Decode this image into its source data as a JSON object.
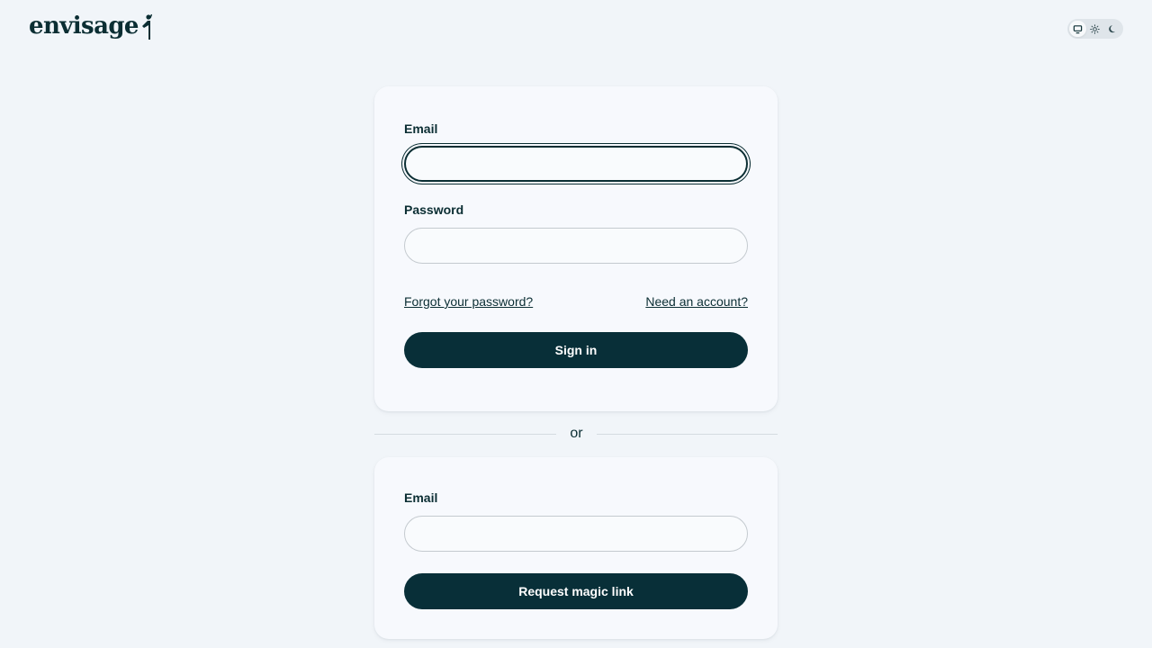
{
  "header": {
    "logo_text": "envisage",
    "theme_options": [
      {
        "icon": "monitor-icon",
        "active": true
      },
      {
        "icon": "sun-icon",
        "active": false
      },
      {
        "icon": "moon-icon",
        "active": false
      }
    ]
  },
  "password_login": {
    "email_label": "Email",
    "email_value": "",
    "password_label": "Password",
    "password_value": "",
    "forgot_link": "Forgot your password?",
    "signup_link": "Need an account?",
    "submit_label": "Sign in"
  },
  "divider": {
    "text": "or"
  },
  "magic_link": {
    "email_label": "Email",
    "email_value": "",
    "submit_label": "Request magic link"
  },
  "colors": {
    "background": "#f1f5f9",
    "card": "#f7f9fd",
    "primary": "#082f38",
    "text": "#0b2e33"
  }
}
